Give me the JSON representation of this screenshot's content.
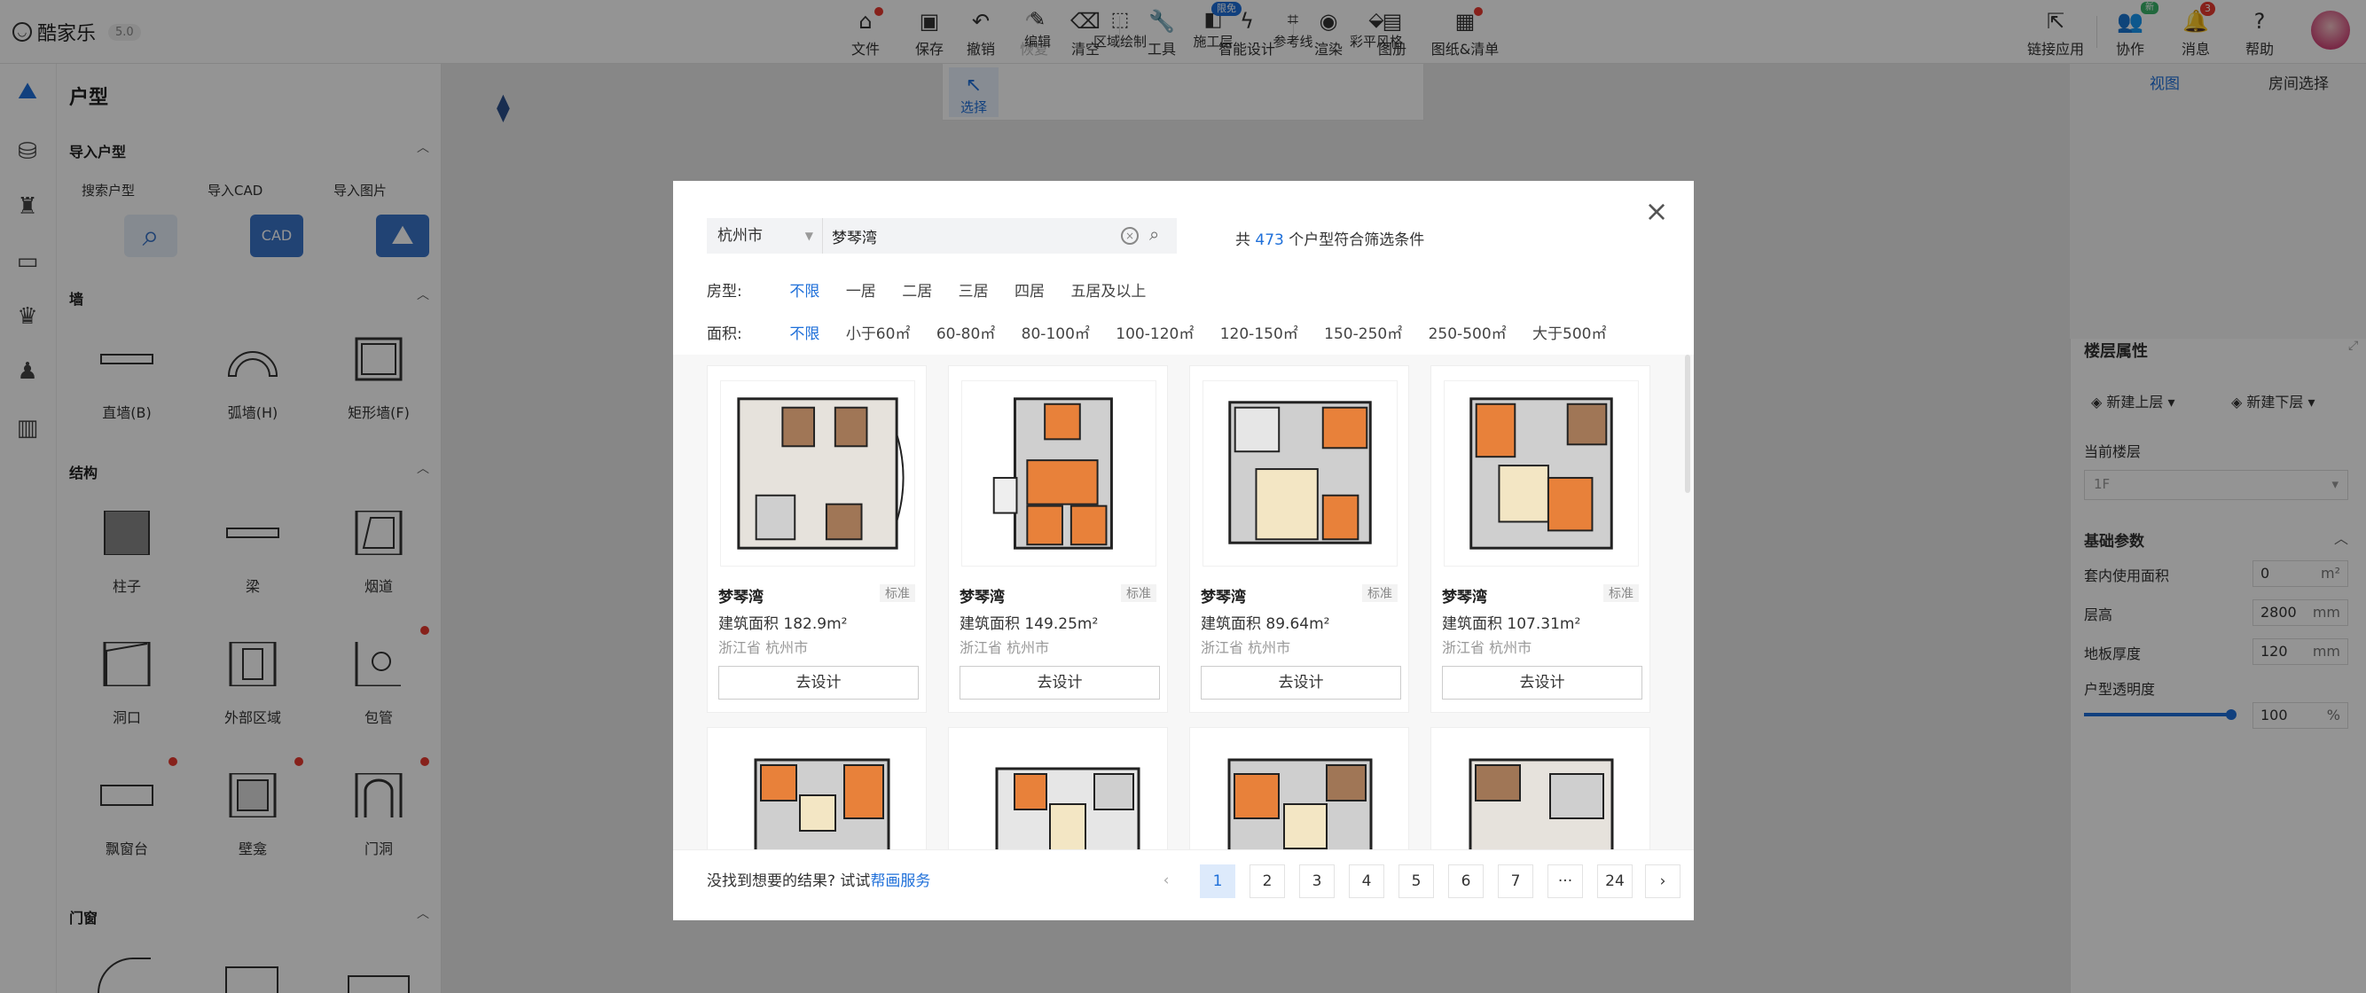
{
  "app": {
    "logo": "酷家乐",
    "version": "5.0"
  },
  "toolbar": {
    "items": [
      {
        "label": "文件",
        "icon": "file-home-icon"
      },
      {
        "label": "保存",
        "icon": "save-icon"
      },
      {
        "label": "撤销",
        "icon": "undo-icon"
      },
      {
        "label": "恢复",
        "icon": "redo-icon"
      },
      {
        "label": "清空",
        "icon": "eraser-icon"
      },
      {
        "label": "工具",
        "icon": "wrench-icon"
      },
      {
        "label": "智能设计",
        "icon": "lightning-icon"
      },
      {
        "label": "渲染",
        "icon": "camera-icon"
      },
      {
        "label": "图册",
        "icon": "album-icon"
      },
      {
        "label": "图纸&清单",
        "icon": "drawings-list-icon"
      }
    ],
    "right": [
      {
        "label": "链接应用",
        "icon": "link-app-icon"
      },
      {
        "label": "协作",
        "icon": "collab-icon",
        "badge": "新"
      },
      {
        "label": "消息",
        "icon": "bell-icon",
        "badge": "3"
      },
      {
        "label": "帮助",
        "icon": "help-icon"
      }
    ]
  },
  "subtoolbar": {
    "items": [
      {
        "label": "选择"
      },
      {
        "label": "编辑"
      },
      {
        "label": "区域绘制"
      },
      {
        "label": "施工层",
        "badge": "限免"
      },
      {
        "label": "参考线"
      },
      {
        "label": "彩平风格"
      }
    ]
  },
  "leftpanel": {
    "title": "户型",
    "section_import": "导入户型",
    "imports": [
      {
        "label": "搜索户型"
      },
      {
        "label": "导入CAD",
        "pic_text": "CAD"
      },
      {
        "label": "导入图片"
      }
    ],
    "section_wall": "墙",
    "walls": [
      "直墙(B)",
      "弧墙(H)",
      "矩形墙(F)"
    ],
    "section_struct": "结构",
    "structs": [
      "柱子",
      "梁",
      "烟道",
      "洞口",
      "外部区域",
      "包管",
      "飘窗台",
      "壁龛",
      "门洞"
    ],
    "section_door": "门窗"
  },
  "rightpanel": {
    "tabs": [
      "视图",
      "房间选择"
    ],
    "floor_title": "楼层属性",
    "new_up": "新建上层",
    "new_down": "新建下层",
    "current_floor_label": "当前楼层",
    "current_floor_value": "1F",
    "basic_title": "基础参数",
    "params": [
      {
        "label": "套内使用面积",
        "value": "0",
        "unit": "m²"
      },
      {
        "label": "层高",
        "value": "2800",
        "unit": "mm"
      },
      {
        "label": "地板厚度",
        "value": "120",
        "unit": "mm"
      },
      {
        "label": "户型透明度",
        "value": "100",
        "unit": "%"
      }
    ],
    "opacity": 1.0
  },
  "dialog": {
    "city": "杭州市",
    "search_value": "梦琴湾",
    "count_prefix": "共",
    "count": "473",
    "count_suffix": "个户型符合筛选条件",
    "room_label": "房型:",
    "room_options": [
      "不限",
      "一居",
      "二居",
      "三居",
      "四居",
      "五居及以上"
    ],
    "area_label": "面积:",
    "area_options": [
      "不限",
      "小于60㎡",
      "60-80㎡",
      "80-100㎡",
      "100-120㎡",
      "120-150㎡",
      "150-250㎡",
      "250-500㎡",
      "大于500㎡"
    ],
    "cards": [
      {
        "name": "梦琴湾",
        "tag": "标准",
        "area": "建筑面积 182.9m²",
        "loc": "浙江省 杭州市",
        "btn": "去设计"
      },
      {
        "name": "梦琴湾",
        "tag": "标准",
        "area": "建筑面积 149.25m²",
        "loc": "浙江省 杭州市",
        "btn": "去设计"
      },
      {
        "name": "梦琴湾",
        "tag": "标准",
        "area": "建筑面积 89.64m²",
        "loc": "浙江省 杭州市",
        "btn": "去设计"
      },
      {
        "name": "梦琴湾",
        "tag": "标准",
        "area": "建筑面积 107.31m²",
        "loc": "浙江省 杭州市",
        "btn": "去设计"
      }
    ],
    "not_found": "没找到想要的结果? 试试",
    "service_link": "帮画服务",
    "pages": [
      "1",
      "2",
      "3",
      "4",
      "5",
      "6",
      "7",
      "···",
      "24"
    ],
    "current_page": "1"
  },
  "colors": {
    "accent": "#1e6fd9",
    "badge": "#e83a2f",
    "wall": "#222222",
    "room_orange": "#e8813a",
    "room_beige": "#f3e6c4",
    "room_gray": "#cfcfcf",
    "room_brown": "#a07656"
  }
}
